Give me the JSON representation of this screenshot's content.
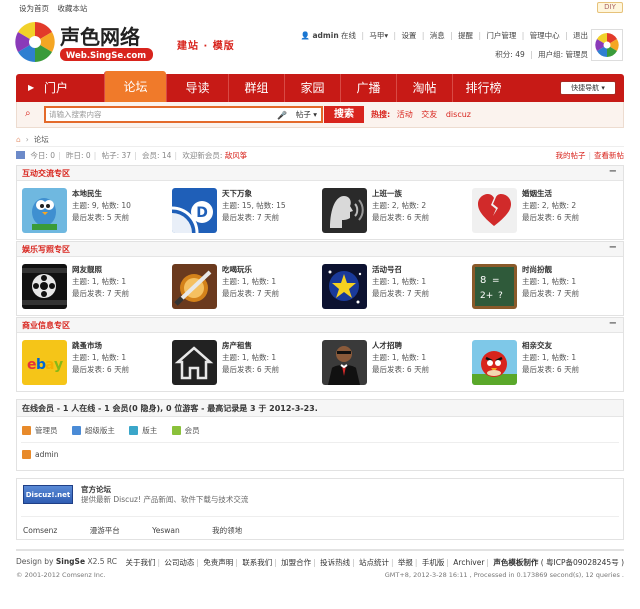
{
  "topbar": {
    "set_home": "设为首页",
    "bookmark": "收藏本站",
    "diy": "DIY"
  },
  "header": {
    "logo_text": "声色网络",
    "logo_url_text": "Web.SingSe.com",
    "tagline": "建站 · 模版"
  },
  "user": {
    "name": "admin",
    "status": "在线",
    "menu_items": [
      "马甲",
      "设置",
      "消息",
      "提醒",
      "门户管理",
      "管理中心",
      "退出"
    ],
    "credits_label": "积分: 49",
    "group_label": "用户组: 管理员"
  },
  "nav": {
    "portal": "门户",
    "items": [
      "论坛",
      "导读",
      "群组",
      "家园",
      "广播",
      "淘帖",
      "排行榜"
    ],
    "active_index": 0,
    "quick_nav": "快捷导航"
  },
  "search": {
    "placeholder": "请输入搜索内容",
    "scope": "帖子",
    "button": "搜索",
    "hot_label": "热搜:",
    "hot_terms": [
      "活动",
      "交友",
      "discuz"
    ]
  },
  "breadcrumb": {
    "current": "论坛"
  },
  "stats": {
    "today": "今日: 0",
    "yesterday": "昨日: 0",
    "posts": "帖子: 37",
    "members": "会员: 14",
    "welcome": "欢迎新会员:",
    "newest_member": "敌风筝",
    "my_posts": "我的帖子",
    "new_posts": "查看新帖"
  },
  "categories": [
    {
      "title": "互动交流专区",
      "forums": [
        {
          "name": "本地民生",
          "threads": "主题: 9, 帖数: 10",
          "last": "最后发表: 5 天前",
          "icon": "twitter-bird-icon"
        },
        {
          "name": "天下万象",
          "threads": "主题: 15, 帖数: 15",
          "last": "最后发表: 7 天前",
          "icon": "dailybooth-icon"
        },
        {
          "name": "上班一族",
          "threads": "主题: 2, 帖数: 2",
          "last": "最后发表: 6 天前",
          "icon": "voice-profile-icon"
        },
        {
          "name": "婚姻生活",
          "threads": "主题: 2, 帖数: 2",
          "last": "最后发表: 6 天前",
          "icon": "broken-heart-icon"
        }
      ]
    },
    {
      "title": "娱乐写照专区",
      "forums": [
        {
          "name": "网友靓照",
          "threads": "主题: 1, 帖数: 1",
          "last": "最后发表: 7 天前",
          "icon": "film-reel-icon"
        },
        {
          "name": "吃喝玩乐",
          "threads": "主题: 1, 帖数: 1",
          "last": "最后发表: 7 天前",
          "icon": "fruit-ninja-icon"
        },
        {
          "name": "活动号召",
          "threads": "主题: 1, 帖数: 1",
          "last": "最后发表: 7 天前",
          "icon": "star-game-icon"
        },
        {
          "name": "时尚扮靓",
          "threads": "主题: 1, 帖数: 1",
          "last": "最后发表: 7 天前",
          "icon": "chalkboard-icon"
        }
      ]
    },
    {
      "title": "商业信息专区",
      "forums": [
        {
          "name": "跳蚤市场",
          "threads": "主题: 1, 帖数: 1",
          "last": "最后发表: 6 天前",
          "icon": "ebay-icon"
        },
        {
          "name": "房产租售",
          "threads": "主题: 1, 帖数: 1",
          "last": "最后发表: 6 天前",
          "icon": "home-icon"
        },
        {
          "name": "人才招聘",
          "threads": "主题: 1, 帖数: 1",
          "last": "最后发表: 6 天前",
          "icon": "businessman-icon"
        },
        {
          "name": "相亲交友",
          "threads": "主题: 1, 帖数: 1",
          "last": "最后发表: 6 天前",
          "icon": "angry-bird-icon"
        }
      ]
    }
  ],
  "online": {
    "summary": "在线会员 - 1 人在线 - 1 会员(0 隐身), 0 位游客 - 最高记录是 3 于 2012-3-23.",
    "groups": [
      {
        "label": "管理员",
        "color": "#e88a2a"
      },
      {
        "label": "超级版主",
        "color": "#4a8bd6"
      },
      {
        "label": "版主",
        "color": "#3aa6c9"
      },
      {
        "label": "会员",
        "color": "#8ac13a"
      }
    ],
    "users": [
      "admin"
    ]
  },
  "links": {
    "badge": "Discuz!.net",
    "name": "官方论坛",
    "desc": "提供最新 Discuz! 产品新闻、软件下载与技术交流",
    "text_links": [
      "Comsenz",
      "漫游平台",
      "Yeswan",
      "我的领地"
    ]
  },
  "footer": {
    "design_by": "Design by",
    "brand": "SingSe",
    "version": "X2.5 RC",
    "copyright": "© 2001-2012 Comsenz Inc.",
    "links": [
      "关于我们",
      "公司动态",
      "免责声明",
      "联系我们",
      "加盟合作",
      "投诉热线",
      "站点统计",
      "举报",
      "手机版",
      "Archiver"
    ],
    "maker": "声色模板制作",
    "icp": "( 粤ICP备09028245号 )",
    "info": "GMT+8, 2012-3-28 16:11 , Processed in 0.173869 second(s), 12 queries ."
  },
  "colors": {
    "brand_red": "#c71a16",
    "accent_orange": "#f07a2a",
    "link_red": "#d8241d"
  }
}
